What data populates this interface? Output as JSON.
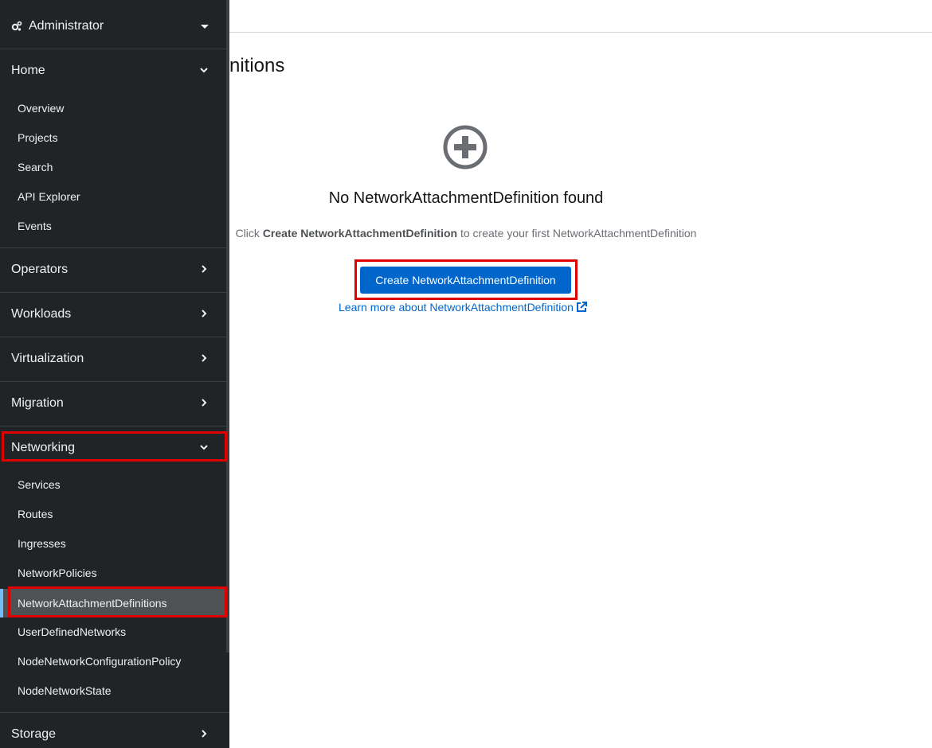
{
  "perspective": {
    "label": "Administrator"
  },
  "sidebar": {
    "sections": [
      {
        "label": "Home",
        "expanded": true,
        "items": [
          "Overview",
          "Projects",
          "Search",
          "API Explorer",
          "Events"
        ]
      },
      {
        "label": "Operators",
        "expanded": false
      },
      {
        "label": "Workloads",
        "expanded": false
      },
      {
        "label": "Virtualization",
        "expanded": false
      },
      {
        "label": "Migration",
        "expanded": false
      },
      {
        "label": "Networking",
        "expanded": true,
        "items": [
          "Services",
          "Routes",
          "Ingresses",
          "NetworkPolicies",
          "NetworkAttachmentDefinitions",
          "UserDefinedNetworks",
          "NodeNetworkConfigurationPolicy",
          "NodeNetworkState"
        ]
      },
      {
        "label": "Storage",
        "expanded": false
      }
    ],
    "active_item": "NetworkAttachmentDefinitions"
  },
  "main": {
    "page_title": "nitions",
    "empty_state": {
      "title": "No NetworkAttachmentDefinition found",
      "body_prefix": "Click ",
      "body_bold": "Create NetworkAttachmentDefinition",
      "body_suffix": " to create your first NetworkAttachmentDefinition",
      "create_button": "Create NetworkAttachmentDefinition",
      "learn_more_link": "Learn more about NetworkAttachmentDefinition"
    }
  },
  "colors": {
    "sidebar_bg": "#212427",
    "primary": "#0066cc",
    "highlight": "#e00000",
    "active_item_bg": "#4f5255"
  }
}
